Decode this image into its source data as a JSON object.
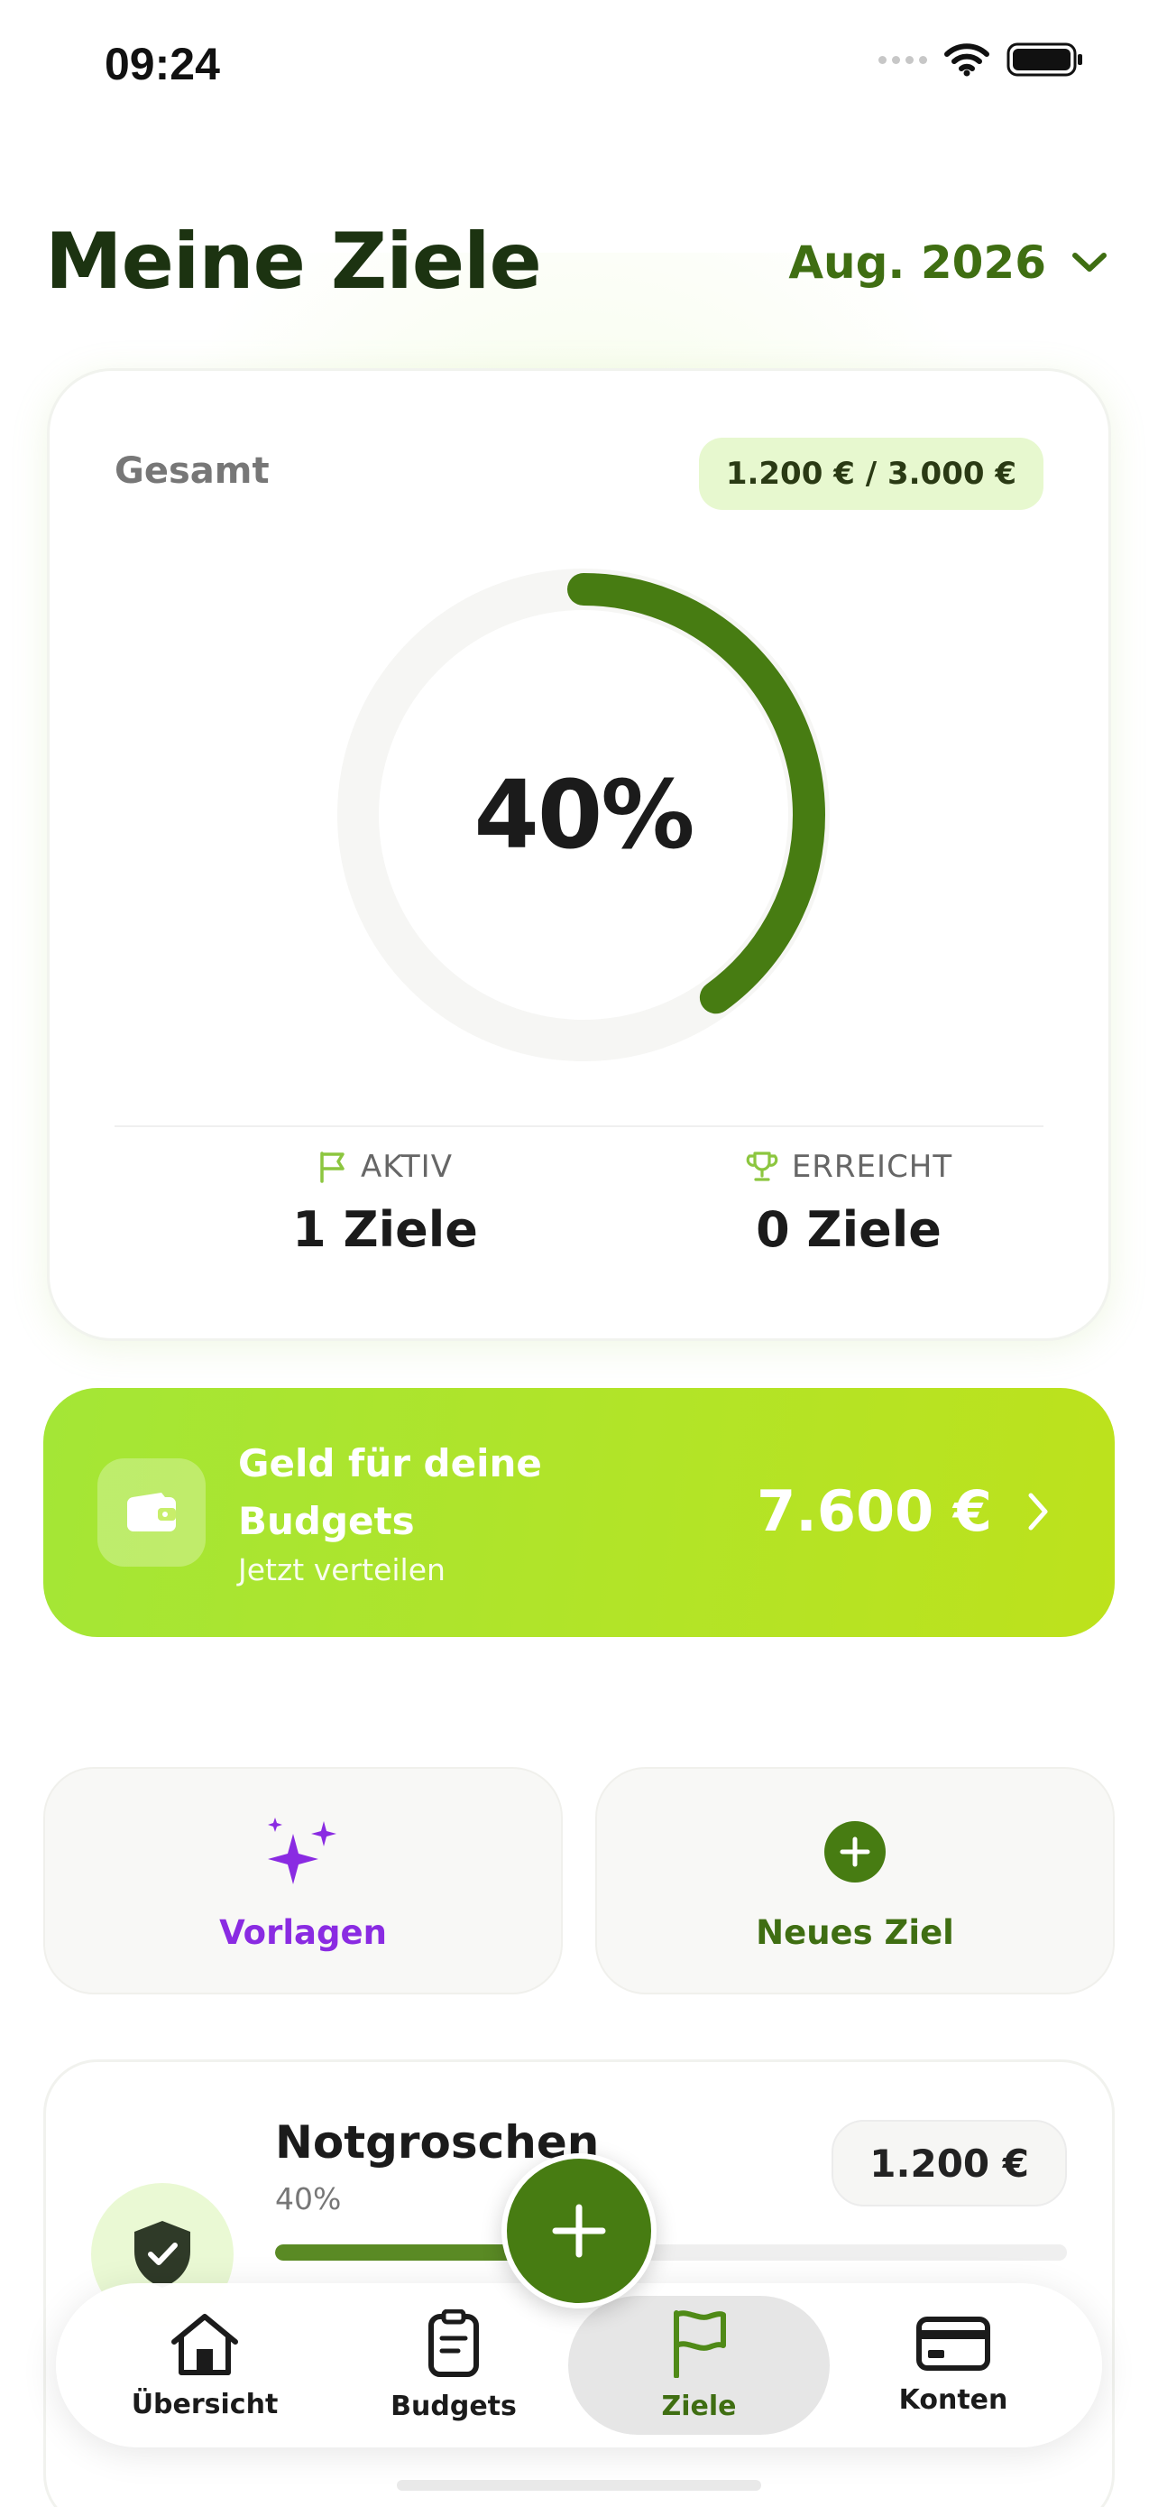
{
  "status_bar": {
    "time": "09:24"
  },
  "header": {
    "title": "Meine Ziele",
    "month": "Aug. 2026"
  },
  "summary": {
    "label": "Gesamt",
    "total": "1.200 € / 3.000 €",
    "progress_text": "40%",
    "progress": 0.4,
    "active_label": "AKTIV",
    "active_value": "1 Ziele",
    "reached_label": "ERREICHT",
    "reached_value": "0 Ziele"
  },
  "budget_banner": {
    "title": "Geld für deine Budgets",
    "subtitle": "Jetzt verteilen",
    "amount": "7.600 €"
  },
  "actions": {
    "templates_label": "Vorlagen",
    "new_goal_label": "Neues Ziel"
  },
  "goals": [
    {
      "name": "Notgroschen",
      "percent": "40%",
      "progress": 0.4,
      "amount": "1.200 €",
      "icon": "shield-check-icon"
    }
  ],
  "tabs": [
    {
      "label": "Übersicht",
      "icon": "home-icon"
    },
    {
      "label": "Budgets",
      "icon": "clipboard-icon"
    },
    {
      "label": "Ziele",
      "icon": "flag-icon"
    },
    {
      "label": "Konten",
      "icon": "card-icon"
    }
  ],
  "colors": {
    "accent": "#477c12",
    "banner_start": "#a4e636",
    "banner_end": "#bde21c",
    "templates": "#8a2be2"
  }
}
